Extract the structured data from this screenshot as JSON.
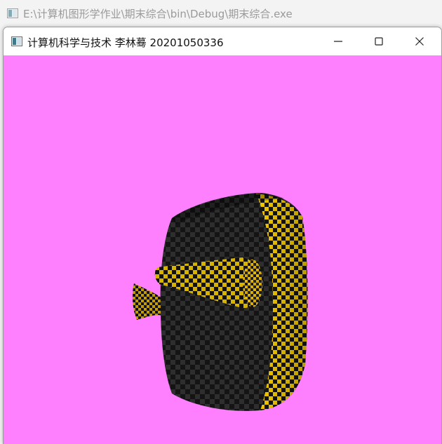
{
  "console": {
    "title": "E:\\计算机图形学作业\\期末综合\\bin\\Debug\\期末综合.exe",
    "icon": "console-app-icon"
  },
  "window": {
    "title": "计算机科学与技术 李林蓦 20201050336",
    "icon": "opengl-app-icon",
    "controls": {
      "minimize_icon": "minimize-icon",
      "maximize_icon": "maximize-icon",
      "close_icon": "close-icon"
    }
  },
  "scene": {
    "background_color": "#ff80ff",
    "object": "checkerboard-textured teapot",
    "texture_colors": [
      "#111111",
      "#f0d000"
    ]
  }
}
